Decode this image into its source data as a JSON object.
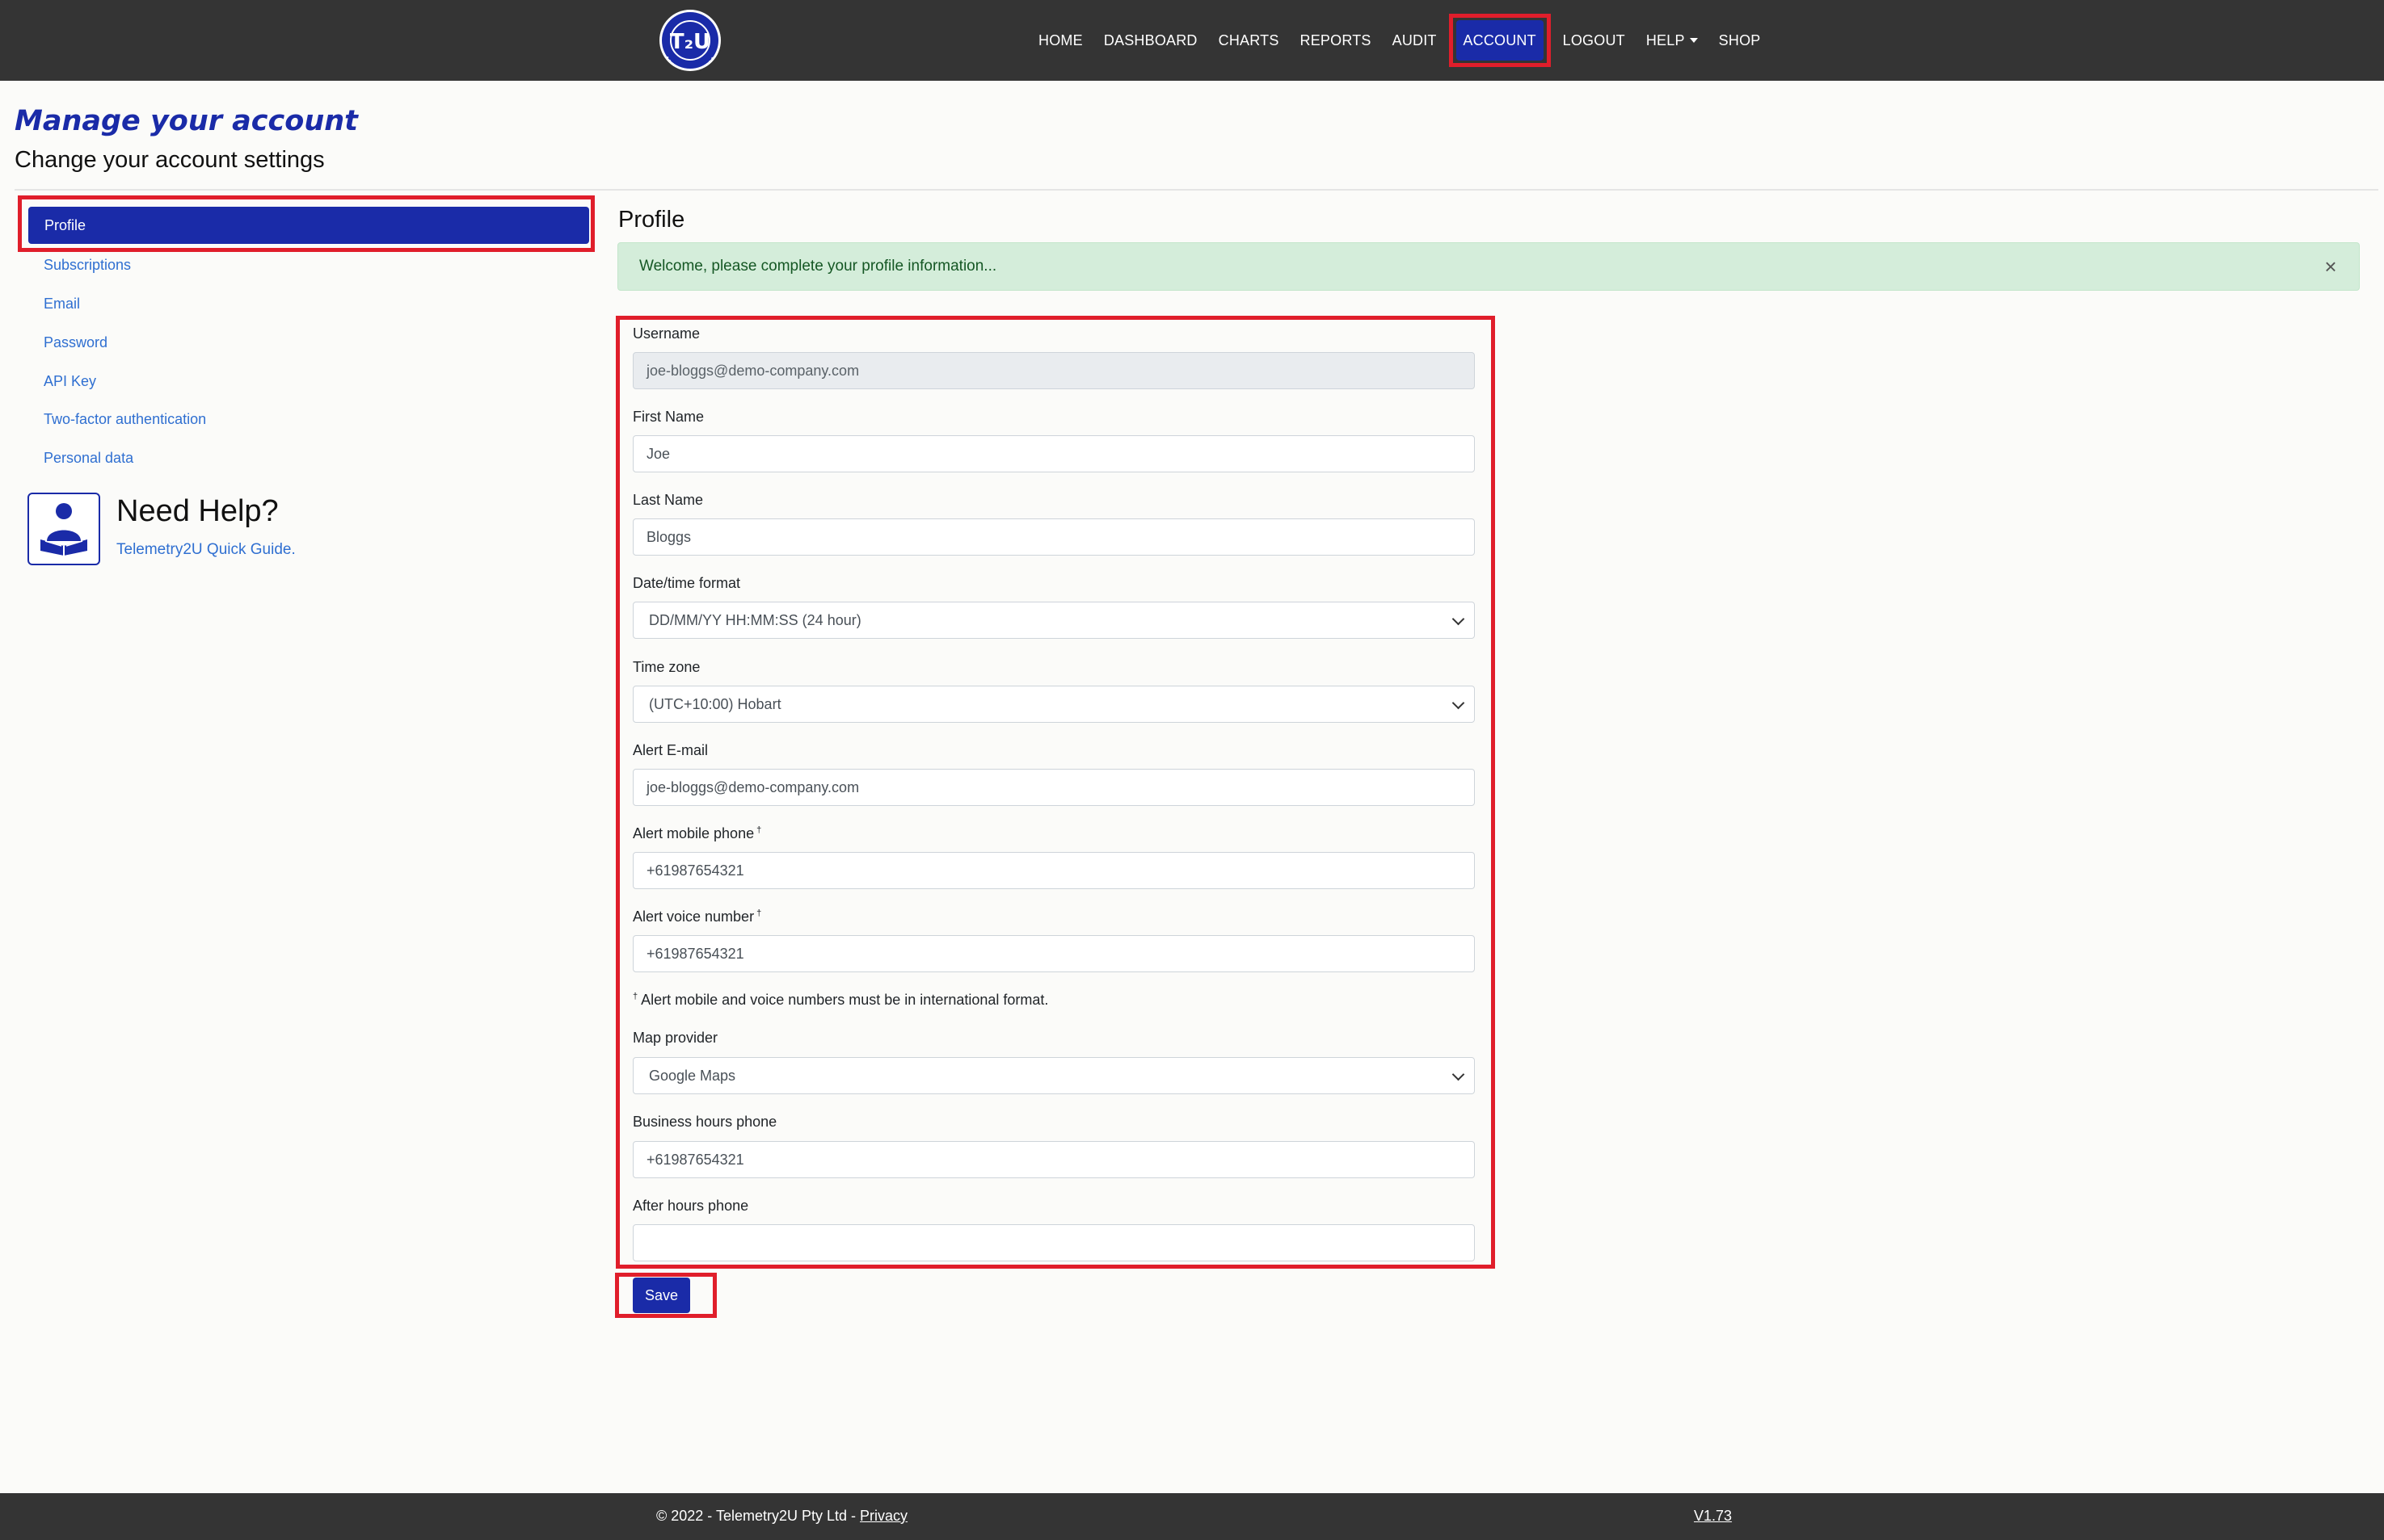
{
  "brand": {
    "logo_text": "T2U",
    "logo_ring_text": "TELEMETRY2U.COM"
  },
  "nav": {
    "items": [
      {
        "label": "HOME"
      },
      {
        "label": "DASHBOARD"
      },
      {
        "label": "CHARTS"
      },
      {
        "label": "REPORTS"
      },
      {
        "label": "AUDIT"
      },
      {
        "label": "ACCOUNT"
      },
      {
        "label": "LOGOUT"
      },
      {
        "label": "HELP"
      },
      {
        "label": "SHOP"
      }
    ],
    "active": "ACCOUNT"
  },
  "header": {
    "title": "Manage your account",
    "subtitle": "Change your account settings"
  },
  "sidebar": {
    "items": [
      {
        "label": "Profile"
      },
      {
        "label": "Subscriptions"
      },
      {
        "label": "Email"
      },
      {
        "label": "Password"
      },
      {
        "label": "API Key"
      },
      {
        "label": "Two-factor authentication"
      },
      {
        "label": "Personal data"
      }
    ],
    "help": {
      "title": "Need Help?",
      "link": "Telemetry2U Quick Guide."
    }
  },
  "main": {
    "section_title": "Profile",
    "alert": "Welcome, please complete your profile information...",
    "alert_close": "×",
    "form": {
      "username_label": "Username",
      "username_value": "joe-bloggs@demo-company.com",
      "first_name_label": "First Name",
      "first_name_value": "Joe",
      "last_name_label": "Last Name",
      "last_name_value": "Bloggs",
      "datetime_label": "Date/time format",
      "datetime_value": "DD/MM/YY HH:MM:SS (24 hour)",
      "timezone_label": "Time zone",
      "timezone_value": "(UTC+10:00) Hobart",
      "alert_email_label": "Alert E-mail",
      "alert_email_value": "joe-bloggs@demo-company.com",
      "alert_mobile_label": "Alert mobile phone",
      "alert_mobile_value": "+61987654321",
      "alert_voice_label": "Alert voice number",
      "alert_voice_value": "+61987654321",
      "dagger": "†",
      "note": "Alert mobile and voice numbers must be in international format.",
      "map_label": "Map provider",
      "map_value": "Google Maps",
      "business_phone_label": "Business hours phone",
      "business_phone_value": "+61987654321",
      "after_hours_label": "After hours phone",
      "after_hours_value": ""
    },
    "save_label": "Save"
  },
  "footer": {
    "copyright": "© 2022 - Telemetry2U Pty Ltd - ",
    "privacy": "Privacy",
    "version": "V1.73"
  },
  "colors": {
    "navbar_bg": "#343434",
    "accent_blue": "#1a2ba8",
    "link_blue": "#2f6fd1",
    "highlight_red": "#e01e2b",
    "alert_green_bg": "#d4edda"
  }
}
